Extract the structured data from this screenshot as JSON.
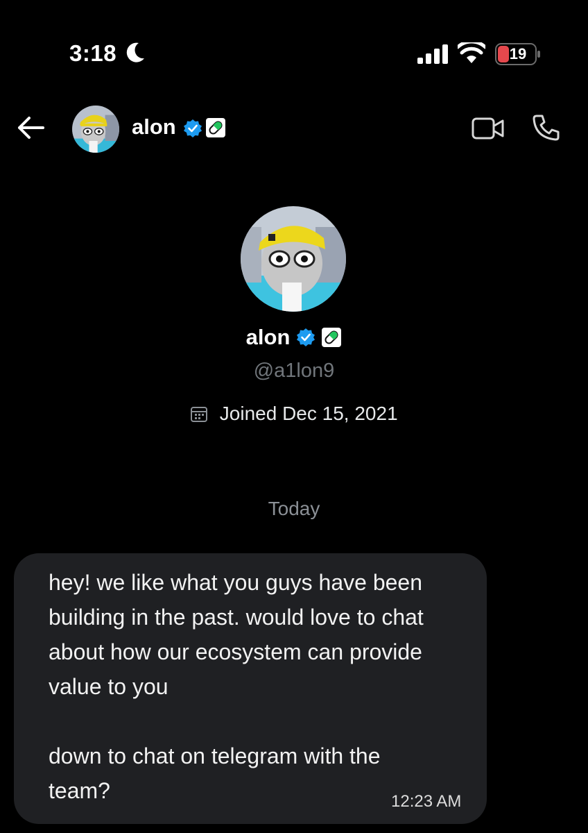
{
  "status_bar": {
    "time": "3:18",
    "battery_level": "19",
    "icons": [
      "moon-icon",
      "cellular-signal-icon",
      "wifi-icon",
      "battery-icon"
    ]
  },
  "header": {
    "name": "alon",
    "icons": [
      "back-arrow-icon",
      "verified-badge-icon",
      "pill-badge-icon",
      "video-call-icon",
      "phone-call-icon"
    ]
  },
  "profile": {
    "name": "alon",
    "handle": "@a1lon9",
    "joined": "Joined Dec 15, 2021"
  },
  "divider": {
    "label": "Today"
  },
  "message": {
    "lines": [
      "hey! we like what you guys have been",
      "building in the past. would love to chat",
      "about how our ecosystem can provide",
      "value to you",
      "",
      "down to chat on telegram with the",
      "team?"
    ],
    "timestamp": "12:23 AM"
  },
  "colors": {
    "background": "#000000",
    "bubble": "#1f2023",
    "verified": "#1d9bf0",
    "pill": "#22c55e",
    "battery_low": "#e5484d",
    "muted_text": "#71767b"
  }
}
